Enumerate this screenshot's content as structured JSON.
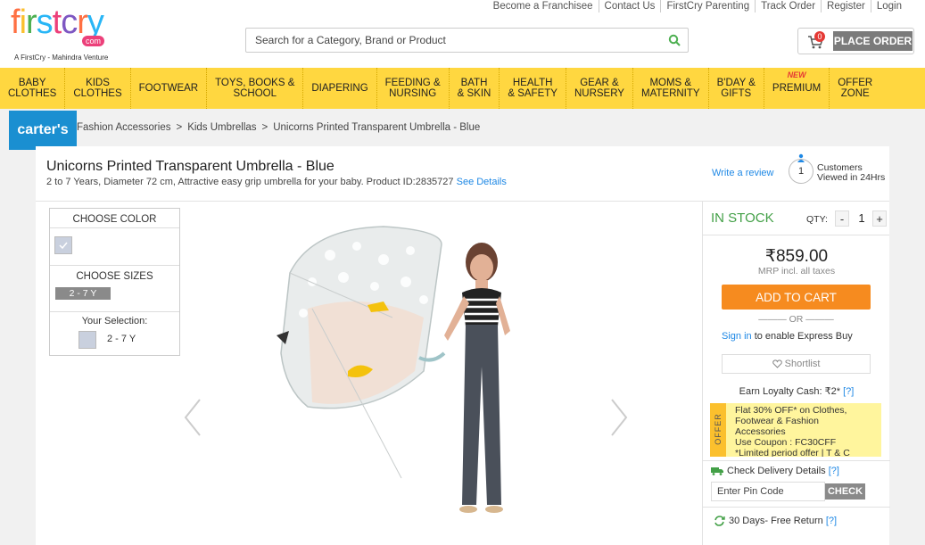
{
  "header": {
    "logo": {
      "letters": [
        "f",
        "i",
        "r",
        "s",
        "t",
        "c",
        "r",
        "y"
      ],
      "com": "com",
      "tagline": "A FirstCry - Mahindra Venture"
    },
    "toplinks": [
      "Become a Franchisee",
      "Contact Us",
      "FirstCry Parenting",
      "Track Order",
      "Register",
      "Login"
    ],
    "search": {
      "placeholder": "Search for a Category, Brand or Product"
    },
    "cart": {
      "count": "0",
      "place_order": "PLACE ORDER"
    }
  },
  "nav": [
    {
      "label": "BABY\nCLOTHES"
    },
    {
      "label": "KIDS\nCLOTHES"
    },
    {
      "label": "FOOTWEAR"
    },
    {
      "label": "TOYS, BOOKS &\nSCHOOL"
    },
    {
      "label": "DIAPERING"
    },
    {
      "label": "FEEDING &\nNURSING"
    },
    {
      "label": "BATH\n& SKIN"
    },
    {
      "label": "HEALTH\n& SAFETY"
    },
    {
      "label": "GEAR &\nNURSERY"
    },
    {
      "label": "MOMS &\nMATERNITY"
    },
    {
      "label": "B'DAY &\nGIFTS"
    },
    {
      "label": "PREMIUM",
      "badge": "NEW"
    },
    {
      "label": "OFFER\nZONE"
    }
  ],
  "brand": {
    "name": "carter's"
  },
  "breadcrumb": [
    "Fashion Accessories",
    "Kids Umbrellas",
    "Unicorns Printed Transparent Umbrella - Blue"
  ],
  "breadcrumb_sep": ">",
  "product": {
    "title": "Unicorns Printed Transparent Umbrella - Blue",
    "description": "2 to 7 Years, Diameter 72 cm, Attractive easy grip umbrella for your baby. Product ID:2835727",
    "see_details": "See Details",
    "write_review": "Write a review",
    "viewers_count": "1",
    "viewers_text": "Customers Viewed in 24Hrs"
  },
  "options": {
    "choose_color": "CHOOSE COLOR",
    "choose_sizes": "CHOOSE SIZES",
    "size": "2 - 7 Y",
    "your_selection": "Your Selection:",
    "selected_size": "2 - 7 Y",
    "swatch_color": "#c9d0de"
  },
  "buy": {
    "stock": "IN STOCK",
    "qty_label": "QTY:",
    "qty_minus": "-",
    "qty": "1",
    "qty_plus": "+",
    "currency": "₹",
    "price": "859.00",
    "mrp_note": "MRP incl. all taxes",
    "add_to_cart": "ADD TO CART",
    "or": "OR",
    "signin_link": "Sign in",
    "signin_text": " to enable Express Buy",
    "shortlist": "Shortlist",
    "loyalty": "Earn Loyalty Cash: ₹2*",
    "loyalty_help": "[?]",
    "offer_tag": "OFFER",
    "offer_lines": [
      "Flat 30% OFF* on Clothes,",
      "Footwear & Fashion",
      "Accessories",
      "Use Coupon : FC30CFF",
      "*Limited period offer | T & C"
    ],
    "delivery_label": "Check Delivery Details",
    "delivery_help": "[?]",
    "pin_placeholder": "Enter Pin Code",
    "check": "CHECK",
    "returns": "30 Days- Free Return",
    "returns_help": "[?]"
  },
  "colors": {
    "nav_bg": "#ffd740",
    "add_to_cart": "#f68b1f",
    "in_stock": "#43a047",
    "link": "#1e88e5",
    "brand_bg": "#1a8fd1"
  }
}
